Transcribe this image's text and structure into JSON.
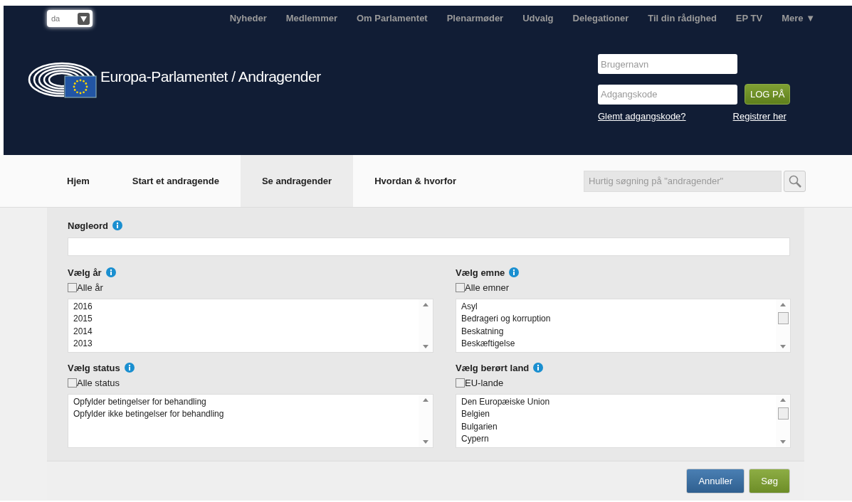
{
  "language": {
    "value": "da"
  },
  "nav": [
    "Nyheder",
    "Medlemmer",
    "Om Parlamentet",
    "Plenarmøder",
    "Udvalg",
    "Delegationer",
    "Til din rådighed",
    "EP TV",
    "Mere ▼"
  ],
  "site_title": "Europa-Parlamentet / Andragender",
  "login": {
    "username_placeholder": "Brugernavn",
    "password_placeholder": "Adgangskode",
    "button": "LOG PÅ",
    "forgot_link": "Glemt adgangskode?",
    "register_link": "Registrer her"
  },
  "tabs": [
    {
      "label": "Hjem",
      "selected": false
    },
    {
      "label": "Start et andragende",
      "selected": false
    },
    {
      "label": "Se andragender",
      "selected": true
    },
    {
      "label": "Hvordan & hvorfor",
      "selected": false
    }
  ],
  "search": {
    "placeholder": "Hurtig søgning på \"andragender\""
  },
  "keyword": {
    "label": "Nøgleord"
  },
  "filters": [
    {
      "label": "Vælg år",
      "checkbox": {
        "label": "Alle år",
        "checked": false
      },
      "options": [
        "2016",
        "2015",
        "2014",
        "2013"
      ],
      "scroll_thumb": false
    },
    {
      "label": "Vælg emne",
      "checkbox": {
        "label": "Alle emner",
        "checked": false
      },
      "options": [
        "Asyl",
        "Bedrageri og korruption",
        "Beskatning",
        "Beskæftigelse"
      ],
      "scroll_thumb": true
    },
    {
      "label": "Vælg status",
      "checkbox": {
        "label": "Alle status",
        "checked": false
      },
      "options": [
        "Opfylder betingelser for behandling",
        "Opfylder ikke betingelser for behandling"
      ],
      "scroll_thumb": false
    },
    {
      "label": "Vælg berørt land",
      "checkbox": {
        "label": "EU-lande",
        "checked": false
      },
      "options": [
        "Den Europæiske Union",
        "Belgien",
        "Bulgarien",
        "Cypern"
      ],
      "scroll_thumb": true
    }
  ],
  "buttons": [
    {
      "label": "Annuller",
      "kind": "secondary"
    },
    {
      "label": "Søg",
      "kind": "primary"
    }
  ]
}
